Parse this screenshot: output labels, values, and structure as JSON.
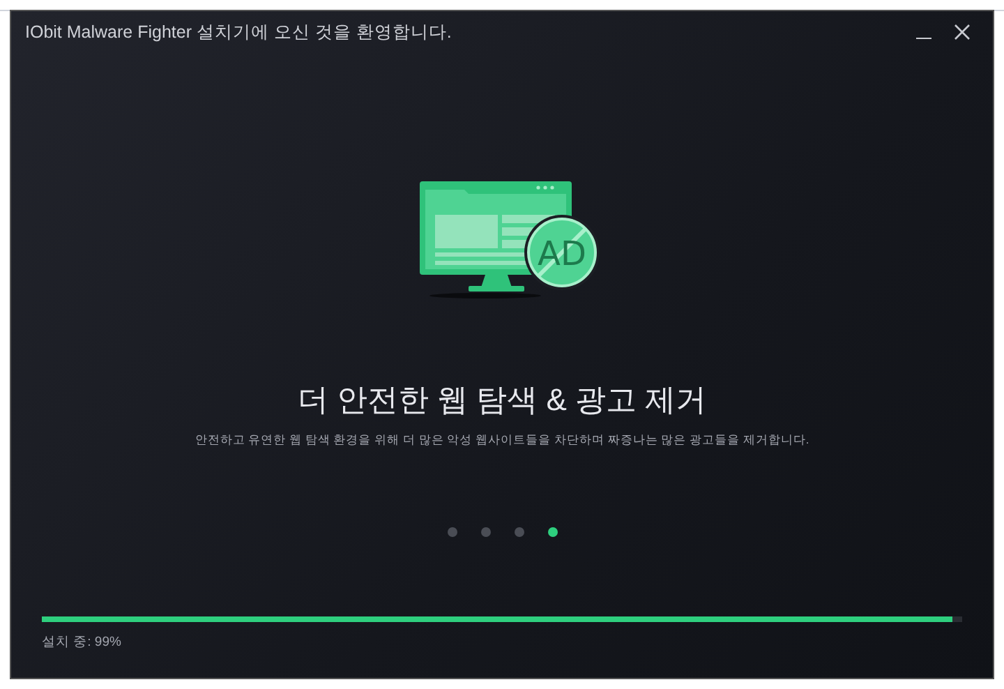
{
  "window": {
    "title": "IObit Malware Fighter 설치기에 오신 것을 환영합니다."
  },
  "feature": {
    "badge_text": "AD",
    "heading": "더 안전한 웹 탐색 & 광고 제거",
    "description": "안전하고 유연한 웹 탐색 환경을 위해 더 많은 악성 웹사이트들을 차단하며 짜증나는 많은 광고들을 제거합니다."
  },
  "pager": [
    {
      "selected": false
    },
    {
      "selected": false
    },
    {
      "selected": false
    },
    {
      "selected": true
    }
  ],
  "progress": {
    "level": 0.99,
    "status": "설치 중: 99%"
  }
}
